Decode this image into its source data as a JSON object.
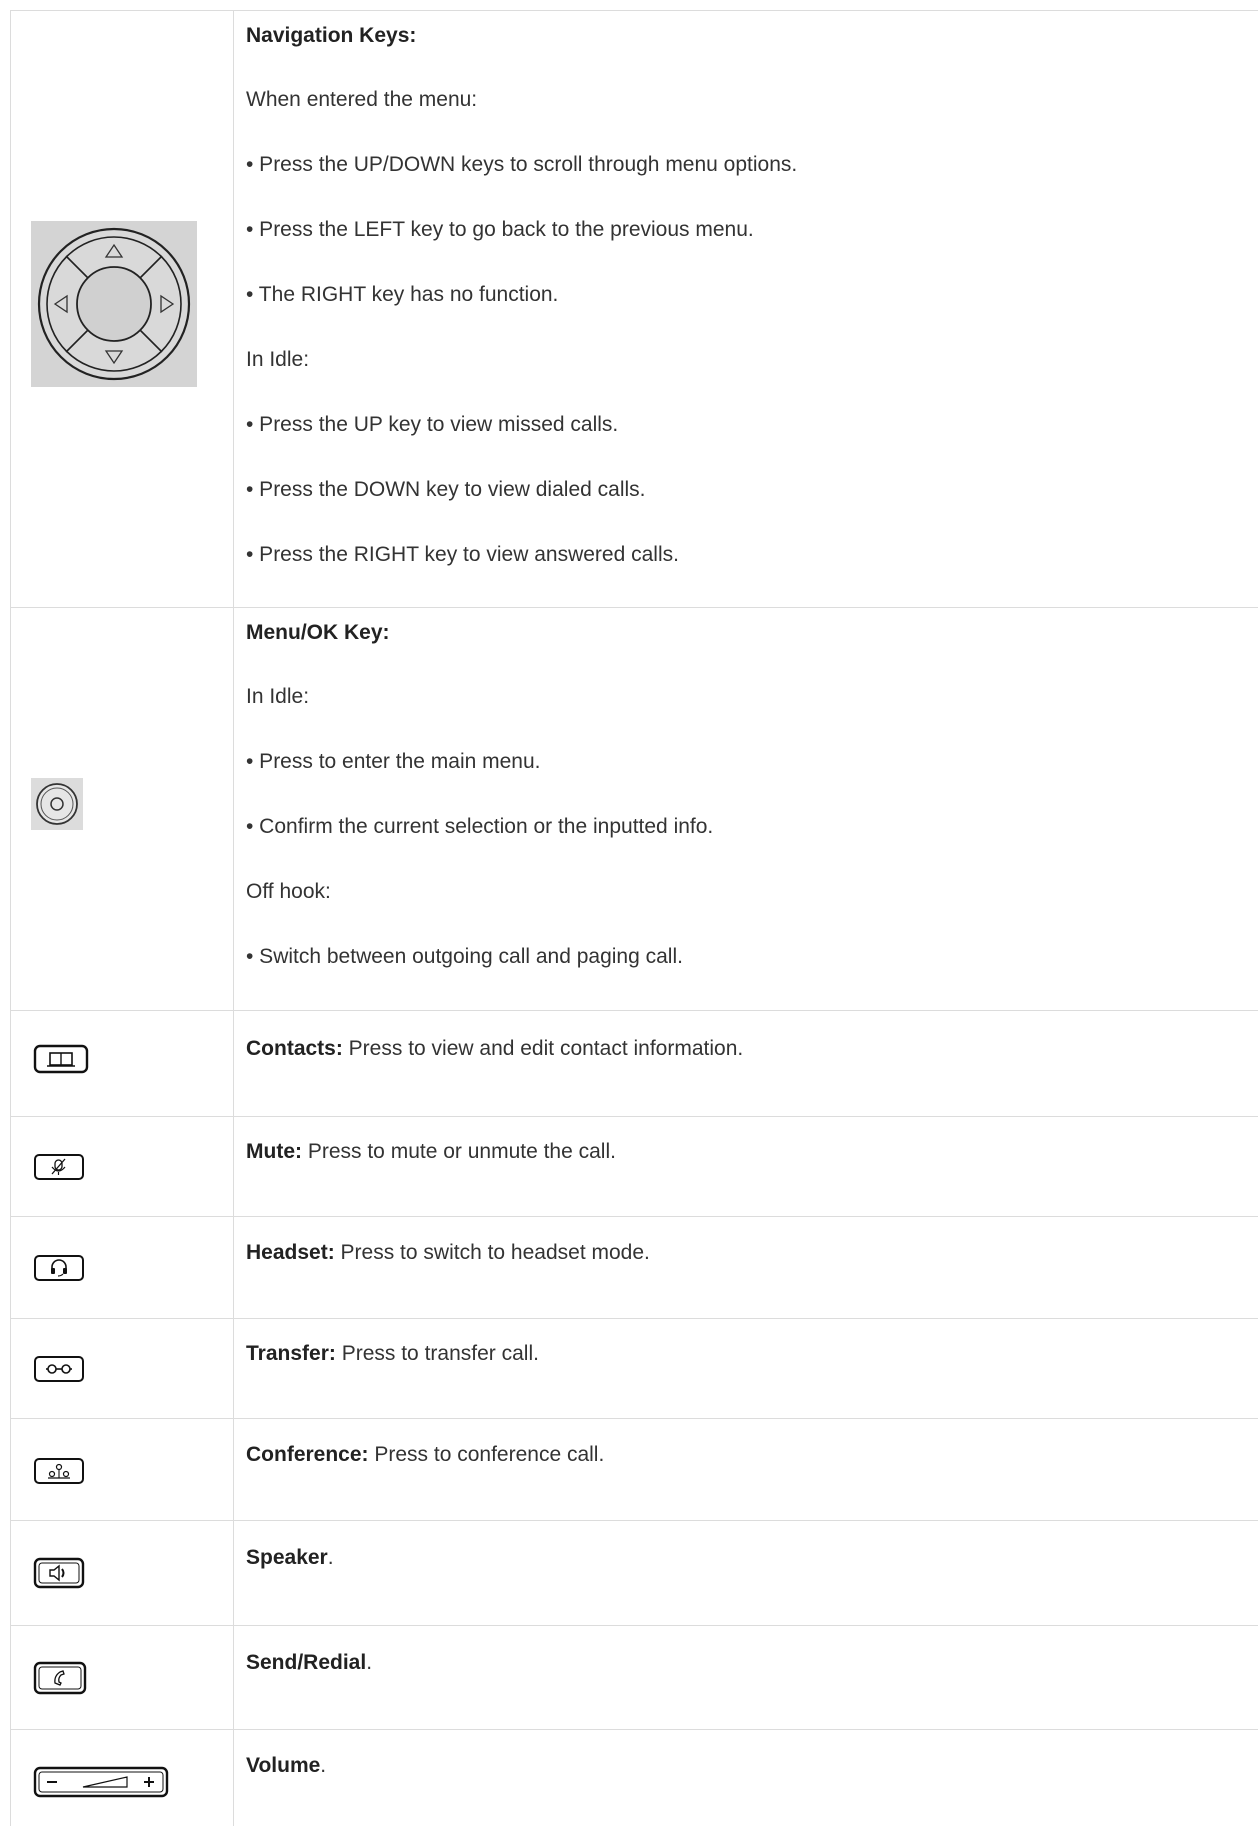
{
  "rows": [
    {
      "id": "navigation",
      "title": "Navigation Keys:",
      "icon": "navigation-pad-icon",
      "lines": [
        "When entered the menu:",
        "• Press the UP/DOWN keys to scroll through menu options.",
        "• Press the LEFT key to go back to the previous menu.",
        "• The RIGHT key has no function.",
        "In Idle:",
        "• Press the UP key to view missed calls.",
        "• Press the DOWN key to view dialed calls.",
        "• Press the RIGHT key to view answered calls."
      ]
    },
    {
      "id": "menu-ok",
      "title": "Menu/OK Key:",
      "icon": "menu-ok-key-icon",
      "lines": [
        "In Idle:",
        "• Press to enter the main menu.",
        "• Confirm the current selection or the inputted info.",
        "Off hook:",
        "• Switch between outgoing call and paging call."
      ]
    },
    {
      "id": "contacts",
      "title": "Contacts:",
      "desc": " Press to view and edit contact information.",
      "icon": "contacts-book-icon"
    },
    {
      "id": "mute",
      "title": "Mute:",
      "desc": " Press to mute or unmute the call.",
      "icon": "mute-microphone-icon"
    },
    {
      "id": "headset",
      "title": "Headset:",
      "desc": " Press to switch to headset mode.",
      "icon": "headset-icon"
    },
    {
      "id": "transfer",
      "title": "Transfer:",
      "desc": " Press to transfer call.",
      "icon": "transfer-icon"
    },
    {
      "id": "conference",
      "title": "Conference:",
      "desc": " Press to conference call.",
      "icon": "conference-icon"
    },
    {
      "id": "speaker",
      "title": "Speaker",
      "desc": ".",
      "icon": "speaker-icon"
    },
    {
      "id": "send-redial",
      "title": "Send/Redial",
      "desc": ".",
      "icon": "handset-icon"
    },
    {
      "id": "volume",
      "title": "Volume",
      "desc": ".",
      "icon": "volume-rocker-icon"
    }
  ]
}
